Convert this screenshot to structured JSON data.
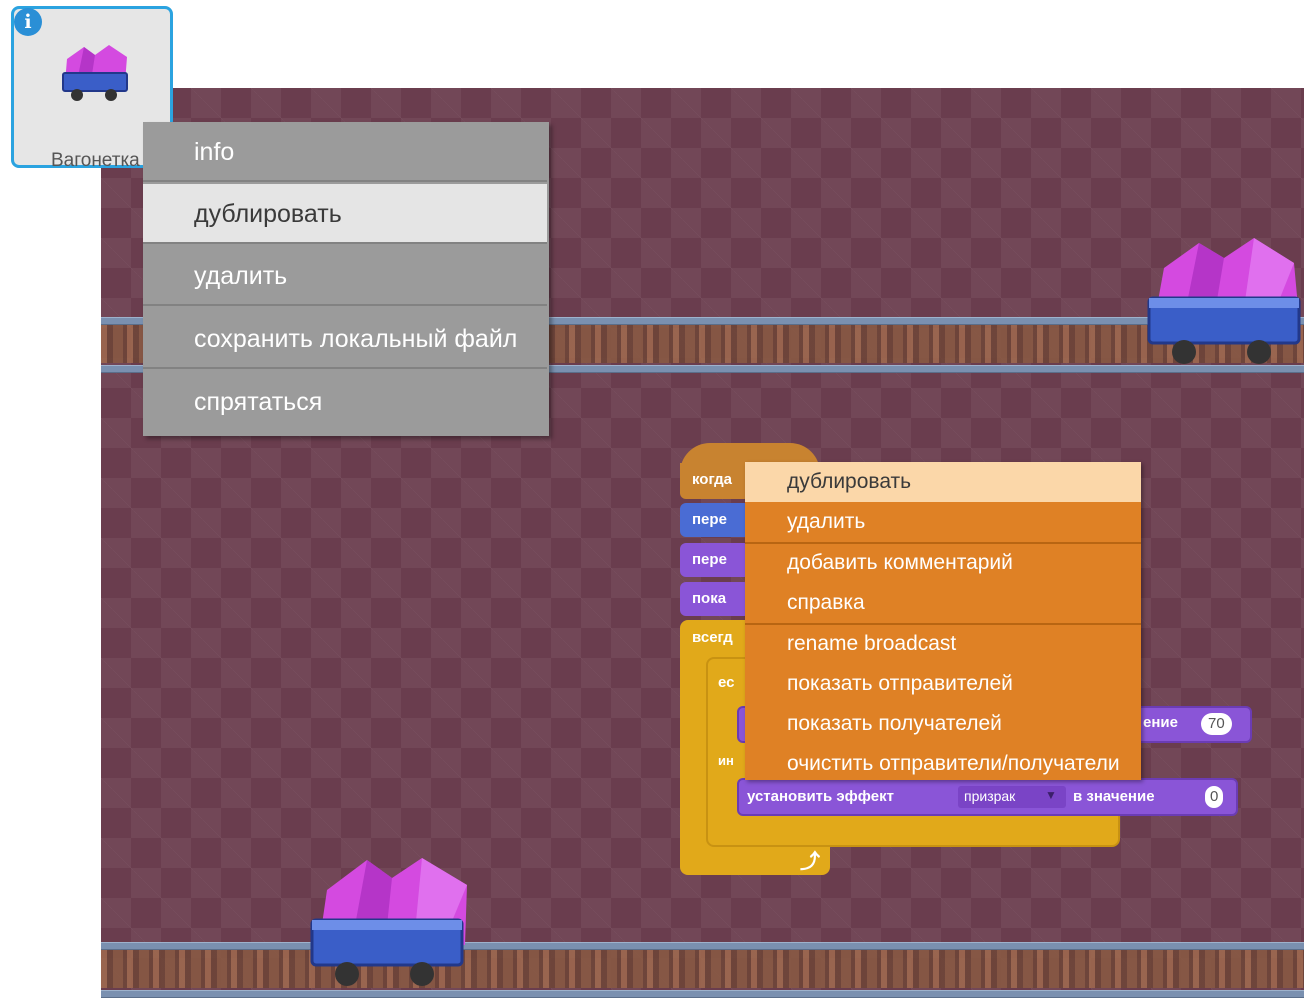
{
  "sprite": {
    "name": "Вагонетка",
    "info_icon": "i"
  },
  "sprite_menu": {
    "items": [
      {
        "label": "info"
      },
      {
        "label": "дублировать"
      },
      {
        "label": "удалить"
      },
      {
        "label": "сохранить локальный файл"
      },
      {
        "label": "спрятаться"
      }
    ],
    "highlighted_index": 1
  },
  "script": {
    "hat_label": "когда",
    "block_labels": [
      "пере",
      "пере",
      "пока",
      "всегд",
      "ес",
      "ин"
    ],
    "set_value_label": "ение",
    "set_value": "70",
    "set_effect": {
      "label": "установить эффект",
      "effect": "призрак",
      "in_value_label": "в значение",
      "value": "0"
    }
  },
  "block_menu": {
    "items": [
      {
        "label": "дублировать"
      },
      {
        "label": "удалить"
      },
      {
        "label": "добавить комментарий"
      },
      {
        "label": "справка"
      },
      {
        "label": "rename broadcast"
      },
      {
        "label": "показать отправителей"
      },
      {
        "label": "показать получателей"
      },
      {
        "label": "очистить отправители/получатели"
      }
    ],
    "highlighted_index": 0
  },
  "colors": {
    "stage_bg": "#6a3d4e",
    "sprite_tile_border": "#2ba3e0",
    "sprite_menu_bg": "#9b9b9b",
    "block_menu_bg": "#df8125",
    "events_block": "#c88330",
    "motion_block": "#4a6cd4",
    "looks_block": "#8a55d7",
    "control_block": "#e1a91a"
  }
}
